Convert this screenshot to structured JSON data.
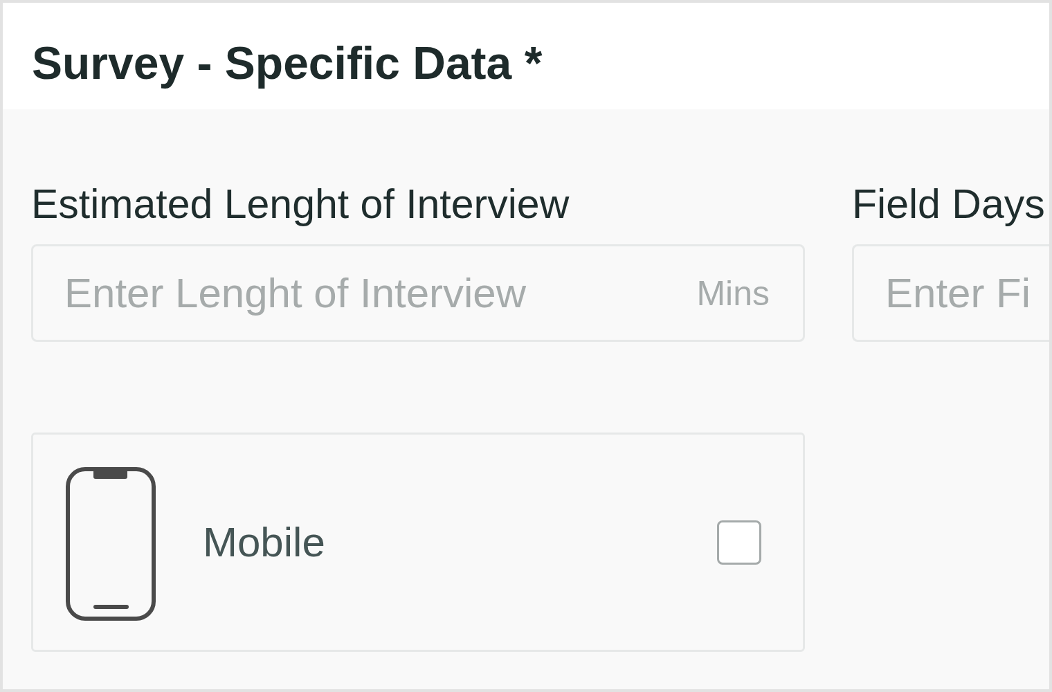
{
  "header": {
    "title": "Survey - Specific Data *"
  },
  "fields": [
    {
      "label": "Estimated Lenght of Interview",
      "placeholder": "Enter Lenght of Interview",
      "suffix": "Mins"
    },
    {
      "label": "Field Days",
      "placeholder": "Enter Fi"
    }
  ],
  "options": [
    {
      "kind": "mobile",
      "label": "Mobile",
      "checked": false
    }
  ]
}
